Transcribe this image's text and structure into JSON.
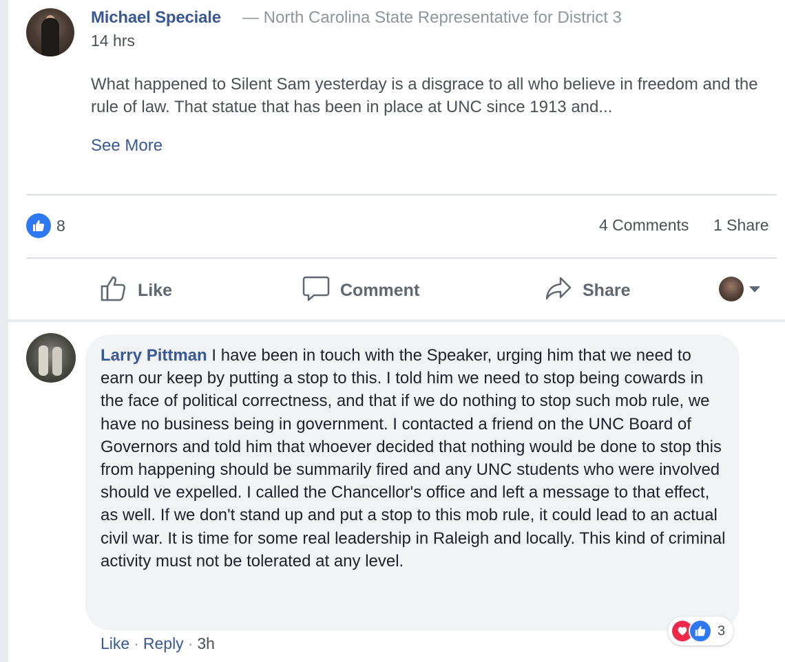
{
  "post": {
    "author": "Michael Speciale",
    "author_subtitle": "— North Carolina State Representative for District 3",
    "timestamp": "14 hrs",
    "body": "What happened to Silent Sam yesterday is a disgrace to all who believe in freedom and the rule of law. That statue that has been in place at UNC since 1913 and...",
    "see_more": "See More",
    "like_count": "8",
    "comments_count": "4 Comments",
    "share_count": "1 Share"
  },
  "actions": {
    "like": "Like",
    "comment": "Comment",
    "share": "Share"
  },
  "comment": {
    "author": "Larry Pittman",
    "text": " I have been in touch with the Speaker, urging him that we need to earn our keep by putting a stop to this. I told him we need to stop being cowards in the face of political correctness, and that if we do nothing to stop such mob rule, we have no business being in government. I contacted a friend on the UNC Board of Governors and told him that whoever decided that nothing would be done to stop this from happening should be summarily fired and any UNC students who were involved should ve expelled. I called the Chancellor's office and left a message to that effect, as well. If we don't stand up and put a stop to this mob rule, it could lead to an actual civil war. It is time for some real leadership in Raleigh and locally. This kind of criminal activity must not be tolerated at any level.",
    "reaction_count": "3",
    "like_label": "Like",
    "reply_label": "Reply",
    "time": "3h"
  },
  "colors": {
    "link": "#385898",
    "like_blue": "#2e78f2",
    "love_red": "#f0284a",
    "secondary_text": "#4b4f56",
    "bubble_bg": "#f2f3f5"
  },
  "icons": [
    "thumbs-up-icon",
    "comment-icon",
    "share-arrow-icon",
    "caret-down-icon",
    "love-reaction-icon",
    "like-reaction-icon"
  ]
}
